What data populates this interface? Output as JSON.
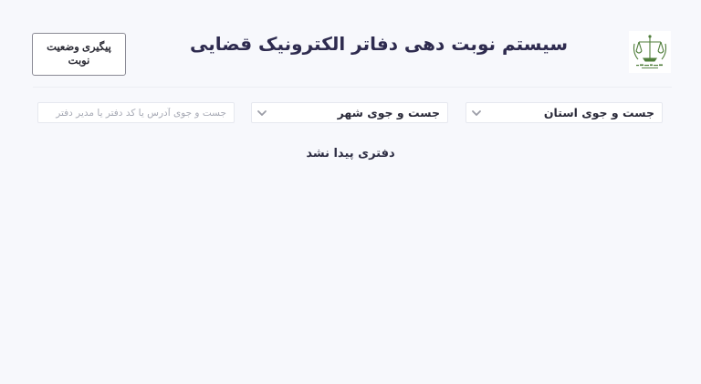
{
  "header": {
    "title": "سیستم نوبت دهی دفاتر الکترونیک قضایی",
    "track_button_label": "پیگیری وضعیت نوبت",
    "logo_icon": "scales-of-justice-icon"
  },
  "filters": {
    "province_label": "جست و جوی استان",
    "city_label": "جست و جوی شهر",
    "search_placeholder": "جست و جوی آدرس یا کد دفتر یا مدیر دفتر"
  },
  "results": {
    "empty_message": "دفتری پیدا نشد"
  },
  "colors": {
    "background": "#f7f8fc",
    "title": "#2e2b4f",
    "logo_green": "#4f7d3a"
  }
}
